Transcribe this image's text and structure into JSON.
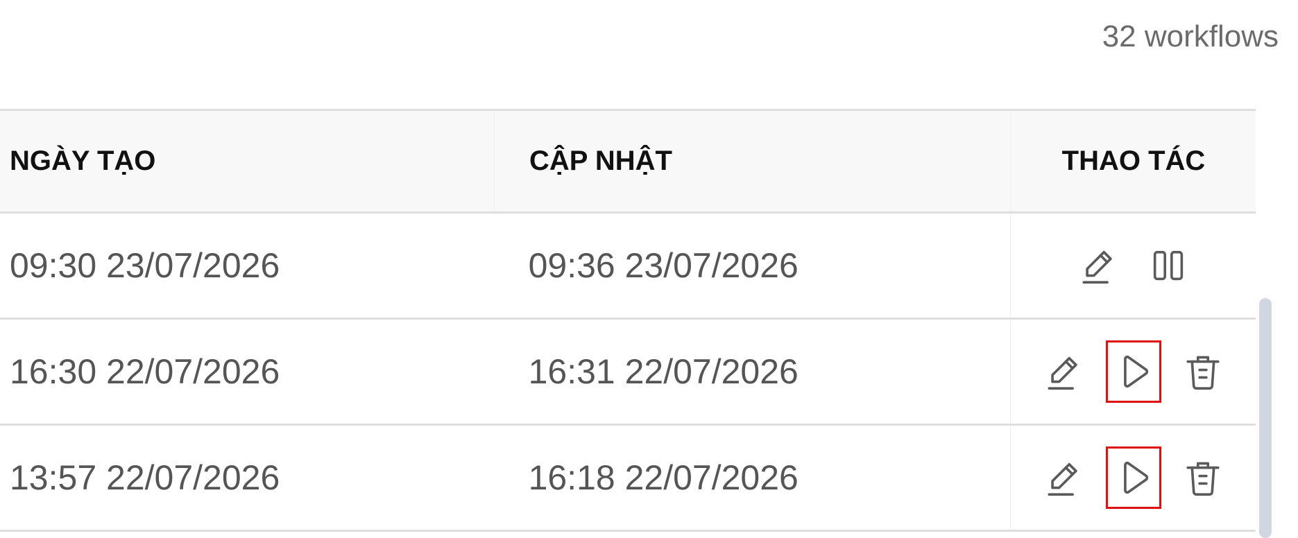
{
  "header": {
    "count_text": "32 workflows"
  },
  "table": {
    "columns": [
      "NGÀY TẠO",
      "CẬP NHẬT",
      "THAO TÁC"
    ],
    "rows": [
      {
        "created": "09:30 23/07/2026",
        "updated": "09:36 23/07/2026",
        "actions": [
          "edit-icon",
          "pause-icon"
        ]
      },
      {
        "created": "16:30 22/07/2026",
        "updated": "16:31 22/07/2026",
        "actions": [
          "edit-icon",
          "play-icon",
          "trash-icon"
        ],
        "highlight": "play-icon"
      },
      {
        "created": "13:57 22/07/2026",
        "updated": "16:18 22/07/2026",
        "actions": [
          "edit-icon",
          "play-icon",
          "trash-icon"
        ],
        "highlight": "play-icon"
      }
    ]
  },
  "colors": {
    "highlight_border": "#e01010",
    "icon": "#5a5a5a",
    "header_bg": "#f8f8f8",
    "scrollbar": "#d0d6e2"
  }
}
